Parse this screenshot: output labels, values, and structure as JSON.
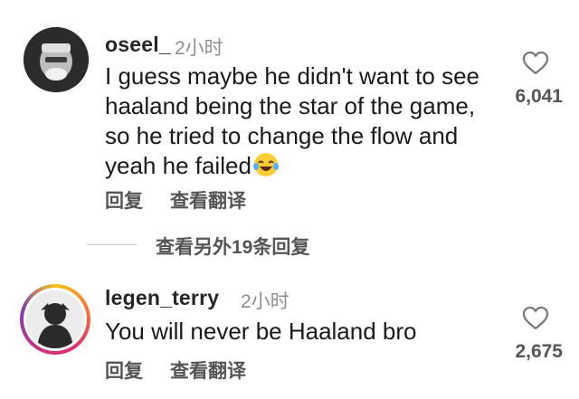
{
  "comments": [
    {
      "username": "oseel_",
      "time": "2小时",
      "text": "I guess maybe he didn't want to see haaland being the star of the game, so he tried to change the flow and yeah he failed",
      "emoji": "laughing-tears-emoji",
      "likes": "6,041",
      "reply_label": "回复",
      "translate_label": "查看翻译"
    },
    {
      "username": "legen_terry",
      "time": "2小时",
      "text": "You will never be Haaland bro",
      "likes": "2,675",
      "reply_label": "回复",
      "translate_label": "查看翻译"
    }
  ],
  "more_replies_label": "查看另外19条回复",
  "icons": {
    "like": "heart-outline-icon"
  },
  "colors": {
    "username": "#262626",
    "muted": "#8e8e8e",
    "action": "#555555",
    "story_ring": [
      "#f5c518",
      "#f77737",
      "#e1306c",
      "#833ab4"
    ]
  }
}
